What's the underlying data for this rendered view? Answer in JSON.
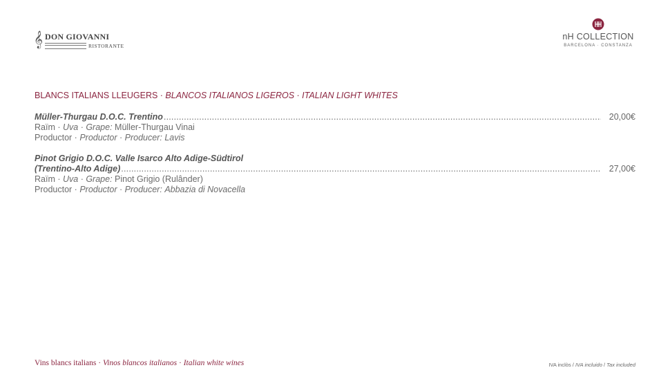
{
  "header": {
    "left_logo": {
      "name": "DON GIOVANNI",
      "subtitle": "RISTORANTE",
      "icon": "treble-clef-icon"
    },
    "right_logo": {
      "name_prefix": "nH",
      "name_suffix": "COLLECTION",
      "subtitle": "BARCELONA · CONSTANZA",
      "icon": "nh-emblem-icon"
    }
  },
  "section": {
    "title_ca": "BLANCS ITALIANS LLEUGERS",
    "separator": " · ",
    "title_es": "BLANCOS ITALIANOS LIGEROS",
    "title_en": "ITALIAN LIGHT WHITES"
  },
  "wines": [
    {
      "name": "Müller-Thurgau D.O.C. Trentino",
      "price": "20,00€",
      "grape_label_ca": "Raïm",
      "grape_label_es": "Uva",
      "grape_label_en": "Grape:",
      "grape": "Müller-Thurgau Vinai",
      "producer_label_ca": "Productor",
      "producer_label_es": "Productor",
      "producer_label_en": "Producer:",
      "producer": "Lavis"
    },
    {
      "name_line1": "Pinot Grigio D.O.C. Valle Isarco Alto Adige-Südtirol",
      "name_line2": "(Trentino-Alto Adige)",
      "price": "27,00€",
      "grape_label_ca": "Raïm",
      "grape_label_es": "Uva",
      "grape_label_en": "Grape:",
      "grape": "Pinot Grigio (Rulânder)",
      "producer_label_ca": "Productor",
      "producer_label_es": "Productor",
      "producer_label_en": "Producer:",
      "producer": "Abbazia di Novacella"
    }
  ],
  "footer": {
    "left_ca": "Vins blancs italians",
    "left_es": "Vinos blancos italianos",
    "left_en": "Italian white wines",
    "tax_ca": "IVA inclòs",
    "tax_es": "IVA incluido",
    "tax_en": "Tax included"
  },
  "colors": {
    "accent": "#8b2540",
    "text": "#6b6b6b"
  }
}
